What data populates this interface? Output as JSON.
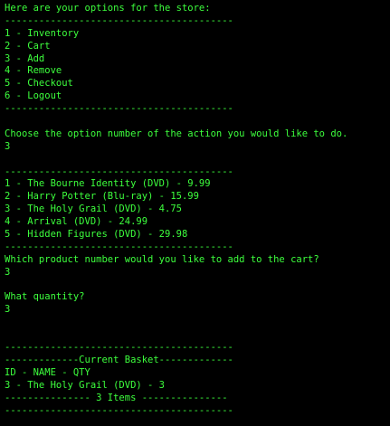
{
  "terminal": {
    "text_color": "#3dff3d",
    "background_color": "#000000",
    "lines": [
      "Here are your options for the store:",
      "----------------------------------------",
      "1 - Inventory",
      "2 - Cart",
      "3 - Add",
      "4 - Remove",
      "5 - Checkout",
      "6 - Logout",
      "----------------------------------------",
      "",
      "Choose the option number of the action you would like to do.",
      "3",
      "",
      "----------------------------------------",
      "1 - The Bourne Identity (DVD) - 9.99",
      "2 - Harry Potter (Blu-ray) - 15.99",
      "3 - The Holy Grail (DVD) - 4.75",
      "4 - Arrival (DVD) - 24.99",
      "5 - Hidden Figures (DVD) - 29.98",
      "----------------------------------------",
      "Which product number would you like to add to the cart?",
      "3",
      "",
      "What quantity?",
      "3",
      "",
      "",
      "----------------------------------------",
      "-------------Current Basket-------------",
      "ID - NAME - QTY",
      "3 - The Holy Grail (DVD) - 3",
      "--------------- 3 Items ---------------",
      "----------------------------------------"
    ]
  }
}
